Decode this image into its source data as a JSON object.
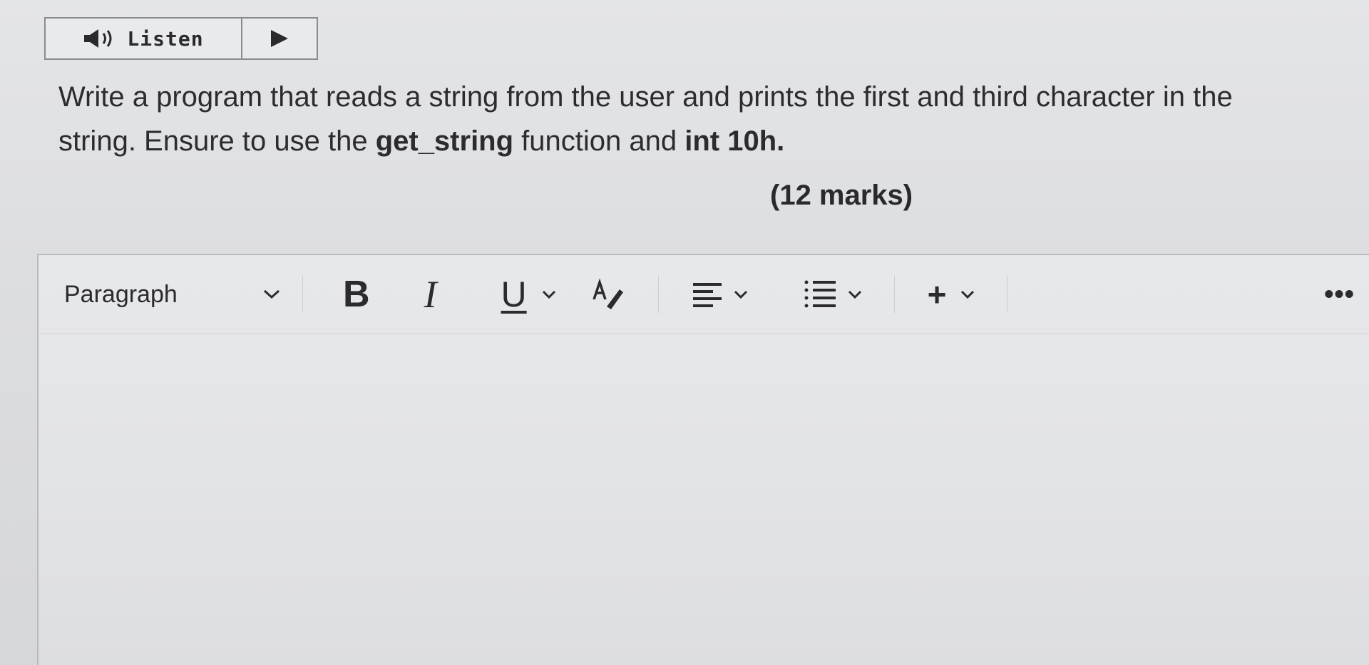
{
  "listen": {
    "label": "Listen",
    "speaker_icon": "speaker-icon",
    "play_icon": "play-icon"
  },
  "question": {
    "part1": "Write a program that reads a string from the user and prints the first and third character in the string. Ensure to use the ",
    "function_name": "get_string",
    "part2": " function and ",
    "interrupt": "int 10h",
    "part3": ".",
    "marks": "(12 marks)"
  },
  "toolbar": {
    "paragraph_label": "Paragraph",
    "bold_label": "B",
    "italic_label": "I",
    "underline_label": "U",
    "more_label": "•••",
    "insert_label": "+"
  },
  "colors": {
    "background": "#dcdde0",
    "text": "#2b2b2d",
    "border": "#8a8b8e"
  }
}
